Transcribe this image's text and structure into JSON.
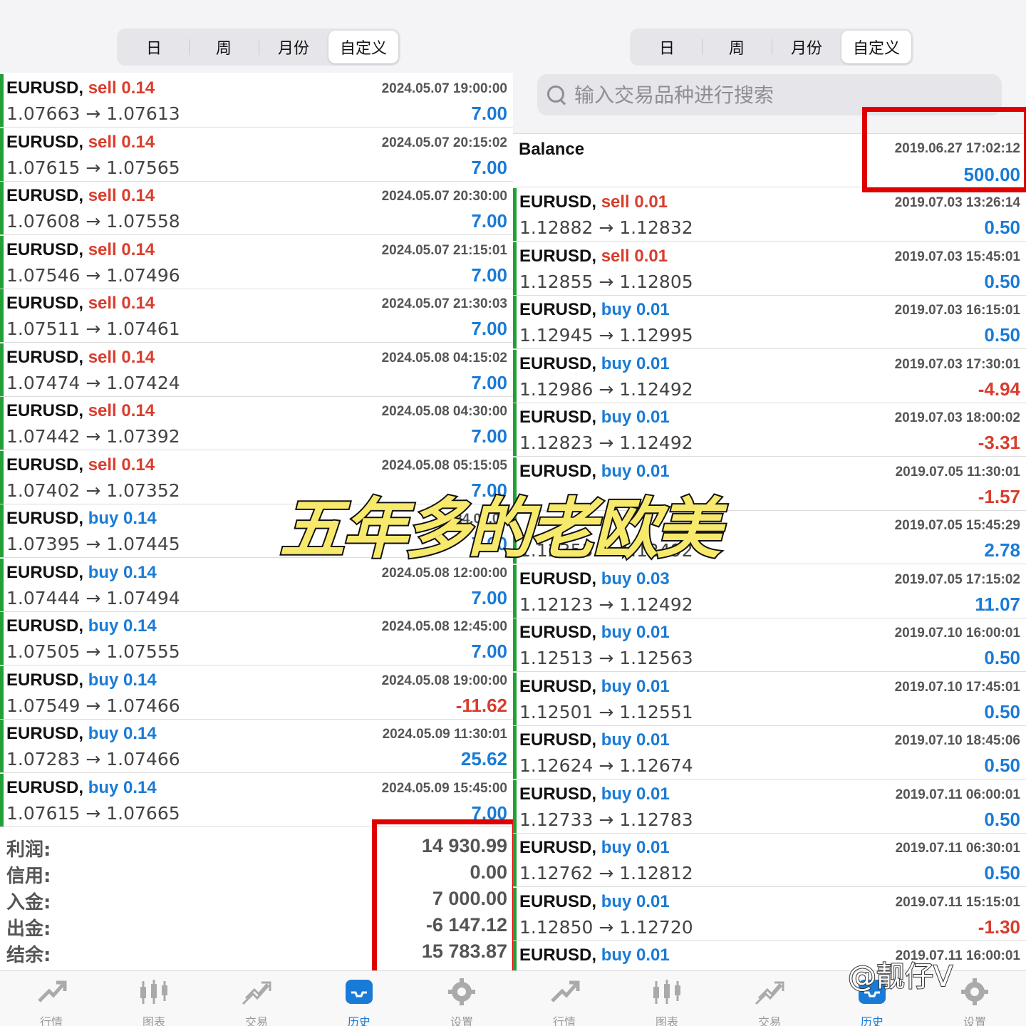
{
  "left": {
    "segments": [
      "日",
      "周",
      "月份",
      "自定义"
    ],
    "active_segment": 3,
    "rows": [
      {
        "symbol": "EURUSD,",
        "type": "sell",
        "volume": "sell 0.14",
        "open": "1.07663",
        "arrow": "→",
        "close": "1.07613",
        "time": "2024.05.07 19:00:00",
        "profit": "7.00",
        "sign": "pos"
      },
      {
        "symbol": "EURUSD,",
        "type": "sell",
        "volume": "sell 0.14",
        "open": "1.07615",
        "arrow": "→",
        "close": "1.07565",
        "time": "2024.05.07 20:15:02",
        "profit": "7.00",
        "sign": "pos"
      },
      {
        "symbol": "EURUSD,",
        "type": "sell",
        "volume": "sell 0.14",
        "open": "1.07608",
        "arrow": "→",
        "close": "1.07558",
        "time": "2024.05.07 20:30:00",
        "profit": "7.00",
        "sign": "pos"
      },
      {
        "symbol": "EURUSD,",
        "type": "sell",
        "volume": "sell 0.14",
        "open": "1.07546",
        "arrow": "→",
        "close": "1.07496",
        "time": "2024.05.07 21:15:01",
        "profit": "7.00",
        "sign": "pos"
      },
      {
        "symbol": "EURUSD,",
        "type": "sell",
        "volume": "sell 0.14",
        "open": "1.07511",
        "arrow": "→",
        "close": "1.07461",
        "time": "2024.05.07 21:30:03",
        "profit": "7.00",
        "sign": "pos"
      },
      {
        "symbol": "EURUSD,",
        "type": "sell",
        "volume": "sell 0.14",
        "open": "1.07474",
        "arrow": "→",
        "close": "1.07424",
        "time": "2024.05.08 04:15:02",
        "profit": "7.00",
        "sign": "pos"
      },
      {
        "symbol": "EURUSD,",
        "type": "sell",
        "volume": "sell 0.14",
        "open": "1.07442",
        "arrow": "→",
        "close": "1.07392",
        "time": "2024.05.08 04:30:00",
        "profit": "7.00",
        "sign": "pos"
      },
      {
        "symbol": "EURUSD,",
        "type": "sell",
        "volume": "sell 0.14",
        "open": "1.07402",
        "arrow": "→",
        "close": "1.07352",
        "time": "2024.05.08 05:15:05",
        "profit": "7.00",
        "sign": "pos"
      },
      {
        "symbol": "EURUSD,",
        "type": "buy",
        "volume": "buy 0.14",
        "open": "1.07395",
        "arrow": "→",
        "close": "1.07445",
        "time": "2024.05.08",
        "profit": "7.00",
        "sign": "pos"
      },
      {
        "symbol": "EURUSD,",
        "type": "buy",
        "volume": "buy 0.14",
        "open": "1.07444",
        "arrow": "→",
        "close": "1.07494",
        "time": "2024.05.08 12:00:00",
        "profit": "7.00",
        "sign": "pos"
      },
      {
        "symbol": "EURUSD,",
        "type": "buy",
        "volume": "buy 0.14",
        "open": "1.07505",
        "arrow": "→",
        "close": "1.07555",
        "time": "2024.05.08 12:45:00",
        "profit": "7.00",
        "sign": "pos"
      },
      {
        "symbol": "EURUSD,",
        "type": "buy",
        "volume": "buy 0.14",
        "open": "1.07549",
        "arrow": "→",
        "close": "1.07466",
        "time": "2024.05.08 19:00:00",
        "profit": "-11.62",
        "sign": "neg"
      },
      {
        "symbol": "EURUSD,",
        "type": "buy",
        "volume": "buy 0.14",
        "open": "1.07283",
        "arrow": "→",
        "close": "1.07466",
        "time": "2024.05.09 11:30:01",
        "profit": "25.62",
        "sign": "pos"
      },
      {
        "symbol": "EURUSD,",
        "type": "buy",
        "volume": "buy 0.14",
        "open": "1.07615",
        "arrow": "→",
        "close": "1.07665",
        "time": "2024.05.09 15:45:00",
        "profit": "7.00",
        "sign": "pos"
      }
    ],
    "summary": [
      {
        "label": "利润:",
        "value": "14 930.99"
      },
      {
        "label": "信用:",
        "value": "0.00"
      },
      {
        "label": "入金:",
        "value": "7 000.00"
      },
      {
        "label": "出金:",
        "value": "-6 147.12"
      },
      {
        "label": "结余:",
        "value": "15 783.87"
      }
    ]
  },
  "right": {
    "segments": [
      "日",
      "周",
      "月份",
      "自定义"
    ],
    "active_segment": 3,
    "search_placeholder": "输入交易品种进行搜索",
    "balance": {
      "label": "Balance",
      "time": "2019.06.27 17:02:12",
      "amount": "500.00"
    },
    "rows": [
      {
        "symbol": "EURUSD,",
        "type": "sell",
        "volume": "sell 0.01",
        "open": "1.12882",
        "arrow": "→",
        "close": "1.12832",
        "time": "2019.07.03 13:26:14",
        "profit": "0.50",
        "sign": "pos"
      },
      {
        "symbol": "EURUSD,",
        "type": "sell",
        "volume": "sell 0.01",
        "open": "1.12855",
        "arrow": "→",
        "close": "1.12805",
        "time": "2019.07.03 15:45:01",
        "profit": "0.50",
        "sign": "pos"
      },
      {
        "symbol": "EURUSD,",
        "type": "buy",
        "volume": "buy 0.01",
        "open": "1.12945",
        "arrow": "→",
        "close": "1.12995",
        "time": "2019.07.03 16:15:01",
        "profit": "0.50",
        "sign": "pos"
      },
      {
        "symbol": "EURUSD,",
        "type": "buy",
        "volume": "buy 0.01",
        "open": "1.12986",
        "arrow": "→",
        "close": "1.12492",
        "time": "2019.07.03 17:30:01",
        "profit": "-4.94",
        "sign": "neg"
      },
      {
        "symbol": "EURUSD,",
        "type": "buy",
        "volume": "buy 0.01",
        "open": "1.12823",
        "arrow": "→",
        "close": "1.12492",
        "time": "2019.07.03 18:00:02",
        "profit": "-3.31",
        "sign": "neg"
      },
      {
        "symbol": "EURUSD,",
        "type": "buy",
        "volume": "buy 0.01",
        "open": "",
        "arrow": "",
        "close": "",
        "time": "2019.07.05 11:30:01",
        "profit": "-1.57",
        "sign": "neg"
      },
      {
        "symbol": "",
        "type": "buy",
        "volume": "",
        "open": "1.12353",
        "arrow": "→",
        "close": "1.12492",
        "time": "2019.07.05 15:45:29",
        "profit": "2.78",
        "sign": "pos"
      },
      {
        "symbol": "EURUSD,",
        "type": "buy",
        "volume": "buy 0.03",
        "open": "1.12123",
        "arrow": "→",
        "close": "1.12492",
        "time": "2019.07.05 17:15:02",
        "profit": "11.07",
        "sign": "pos"
      },
      {
        "symbol": "EURUSD,",
        "type": "buy",
        "volume": "buy 0.01",
        "open": "1.12513",
        "arrow": "→",
        "close": "1.12563",
        "time": "2019.07.10 16:00:01",
        "profit": "0.50",
        "sign": "pos"
      },
      {
        "symbol": "EURUSD,",
        "type": "buy",
        "volume": "buy 0.01",
        "open": "1.12501",
        "arrow": "→",
        "close": "1.12551",
        "time": "2019.07.10 17:45:01",
        "profit": "0.50",
        "sign": "pos"
      },
      {
        "symbol": "EURUSD,",
        "type": "buy",
        "volume": "buy 0.01",
        "open": "1.12624",
        "arrow": "→",
        "close": "1.12674",
        "time": "2019.07.10 18:45:06",
        "profit": "0.50",
        "sign": "pos"
      },
      {
        "symbol": "EURUSD,",
        "type": "buy",
        "volume": "buy 0.01",
        "open": "1.12733",
        "arrow": "→",
        "close": "1.12783",
        "time": "2019.07.11 06:00:01",
        "profit": "0.50",
        "sign": "pos"
      },
      {
        "symbol": "EURUSD,",
        "type": "buy",
        "volume": "buy 0.01",
        "open": "1.12762",
        "arrow": "→",
        "close": "1.12812",
        "time": "2019.07.11 06:30:01",
        "profit": "0.50",
        "sign": "pos"
      },
      {
        "symbol": "EURUSD,",
        "type": "buy",
        "volume": "buy 0.01",
        "open": "1.12850",
        "arrow": "→",
        "close": "1.12720",
        "time": "2019.07.11 15:15:01",
        "profit": "-1.30",
        "sign": "neg"
      },
      {
        "symbol": "EURUSD,",
        "type": "buy",
        "volume": "buy 0.01",
        "open": "",
        "arrow": "",
        "close": "",
        "time": "2019.07.11 16:00:01",
        "profit": "",
        "sign": "pos"
      }
    ]
  },
  "tabs": [
    {
      "label": "行情",
      "icon": "quotes-icon"
    },
    {
      "label": "图表",
      "icon": "chart-icon"
    },
    {
      "label": "交易",
      "icon": "trade-icon"
    },
    {
      "label": "历史",
      "icon": "history-icon"
    },
    {
      "label": "设置",
      "icon": "settings-icon"
    }
  ],
  "active_tab": 3,
  "overlay_title": "五年多的老欧美",
  "watermark": "@靓仔V",
  "colors": {
    "sell": "#d93d2d",
    "buy": "#1a7bd6",
    "profit_pos": "#1a7bd6",
    "profit_neg": "#d93d2d",
    "row_bar": "#21a035",
    "highlight_box": "#e00000"
  }
}
